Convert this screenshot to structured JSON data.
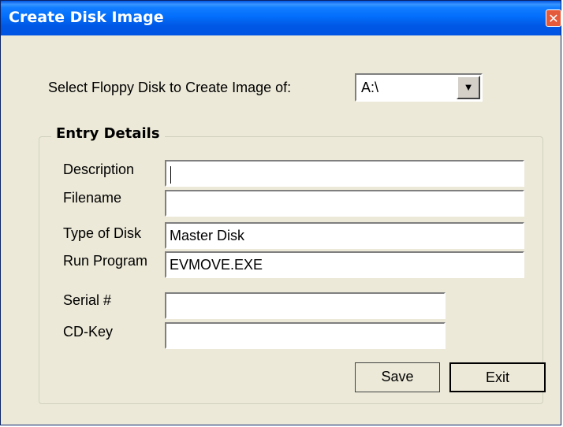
{
  "window": {
    "title": "Create Disk Image",
    "close_glyph": "✕"
  },
  "source": {
    "label": "Select Floppy Disk to Create Image of:",
    "drive_value": "A:\\",
    "dropdown_glyph": "▼"
  },
  "entry": {
    "group_title": "Entry Details",
    "description_label": "Description",
    "description_value": "",
    "filename_label": "Filename",
    "filename_value": "",
    "type_label": "Type of Disk",
    "type_value": "Master Disk",
    "run_label": "Run Program",
    "run_value": "EVMOVE.EXE",
    "serial_label": "Serial #",
    "serial_value": "",
    "cdkey_label": "CD-Key",
    "cdkey_value": ""
  },
  "buttons": {
    "save": "Save",
    "exit": "Exit"
  }
}
